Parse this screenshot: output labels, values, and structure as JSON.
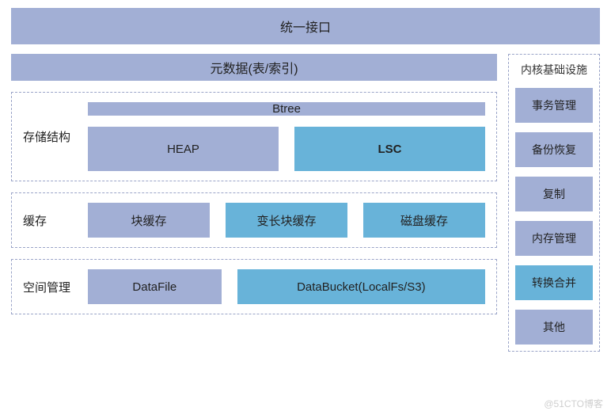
{
  "top": {
    "title": "统一接口"
  },
  "metadata": {
    "label": "元数据(表/索引)"
  },
  "storage": {
    "label": "存储结构",
    "btree": "Btree",
    "heap": "HEAP",
    "lsc": "LSC"
  },
  "cache": {
    "label": "缓存",
    "block": "块缓存",
    "varblock": "变长块缓存",
    "disk": "磁盘缓存"
  },
  "space": {
    "label": "空间管理",
    "datafile": "DataFile",
    "databucket": "DataBucket(LocalFs/S3)"
  },
  "infra": {
    "title": "内核基础设施",
    "items": [
      {
        "label": "事务管理",
        "highlight": false
      },
      {
        "label": "备份恢复",
        "highlight": false
      },
      {
        "label": "复制",
        "highlight": false
      },
      {
        "label": "内存管理",
        "highlight": false
      },
      {
        "label": "转换合并",
        "highlight": true
      },
      {
        "label": "其他",
        "highlight": false
      }
    ]
  },
  "watermark": "@51CTO博客"
}
